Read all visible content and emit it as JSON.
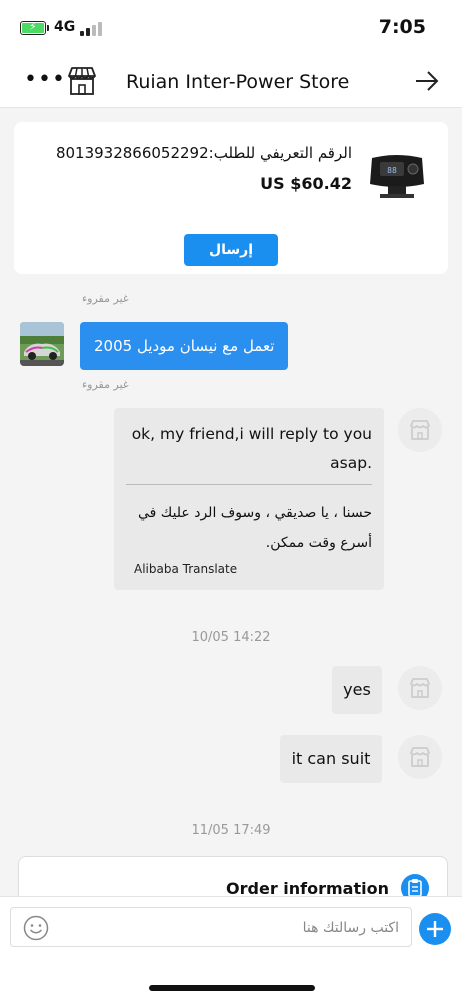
{
  "status_bar": {
    "network": "4G",
    "time": "7:05"
  },
  "header": {
    "title": "Ruian Inter-Power Store",
    "icons": [
      "more-icon",
      "store-icon",
      "arrow-right-icon"
    ]
  },
  "product_card": {
    "order_number": "الرقم التعريفي للطلب:8013932866052292",
    "price": "US $60.42",
    "send_label": "إرسال"
  },
  "messages": {
    "unread_label_1": "غير مقروء",
    "user_message": "تعمل مع نيسان موديل 2005",
    "unread_label_2": "غير مقروء",
    "seller_original": "ok, my friend,i will reply to you asap.",
    "seller_translation": "حسنا ، يا صديقي ، وسوف الرد عليك في أسرع وقت ممكن.",
    "translate_label": "Alibaba Translate",
    "timestamp_1": "10/05 14:22",
    "reply_1": "yes",
    "reply_2": "it can suit",
    "timestamp_2": "11/05 17:49"
  },
  "order_card": {
    "title": "Order information"
  },
  "input_bar": {
    "placeholder": "اكتب رسالتك هنا"
  },
  "colors": {
    "accent": "#1a8ff0",
    "user_bubble": "#2b8ff0",
    "seller_bubble": "#e9e9e9"
  }
}
